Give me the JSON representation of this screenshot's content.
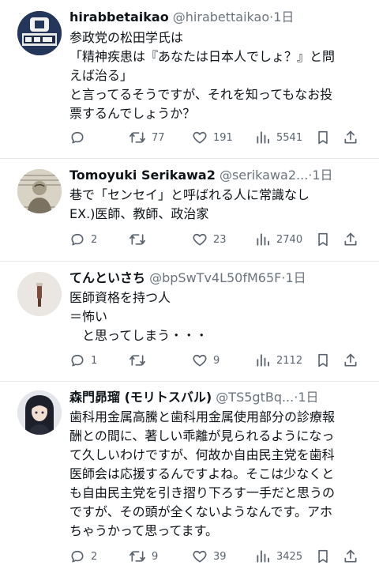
{
  "tweets": [
    {
      "name": "hirabbetaikao",
      "handle": "@hirabettaikao",
      "separator": "·",
      "time": "1日",
      "lines": [
        "参政党の松田学氏は",
        "「精神疾患は『あなたは日本人でしょ？』と問",
        "えば治る」",
        "と言ってるそうですが、それを知ってもなお投",
        "票するんでしょうか？"
      ],
      "replies": "",
      "retweets": "77",
      "likes": "191",
      "views": "5541"
    },
    {
      "name": "Tomoyuki Serikawa2",
      "handle": "@serikawa2...",
      "separator": "·",
      "time": "1日",
      "lines": [
        "巷で「センセイ」と呼ばれる人に常識なし",
        "EX.)医師、教師、政治家"
      ],
      "replies": "2",
      "retweets": "",
      "likes": "23",
      "views": "2740"
    },
    {
      "name": "てんといさち",
      "handle": "@bpSwTv4L50fM65F",
      "separator": "·",
      "time": "1日",
      "lines": [
        "医師資格を持つ人",
        "＝怖い",
        "　と思ってしまう・・・"
      ],
      "replies": "1",
      "retweets": "",
      "likes": "9",
      "views": "2112"
    },
    {
      "name": "森門昴瑠 (モリトスバル)",
      "handle": "@TS5gtBq...",
      "separator": "·",
      "time": "1日",
      "lines": [
        "歯科用金属高騰と歯科用金属使用部分の診療報",
        "酬との間に、著しい乖離が見られるようになっ",
        "て久しいわけですが、何故か自由民主党を歯科",
        "医師会は応援するんですよね。そこは少なくと",
        "も自由民主党を引き摺り下ろす一手だと思うの",
        "ですが、その頭が全くないようなんです。アホ",
        "ちゃうかって思ってます。"
      ],
      "replies": "2",
      "retweets": "9",
      "likes": "39",
      "views": "3425"
    }
  ],
  "colors": {
    "text": "#0f1419",
    "muted": "#6b737c",
    "icon": "#5b6470",
    "divider": "#e6e6e6"
  }
}
